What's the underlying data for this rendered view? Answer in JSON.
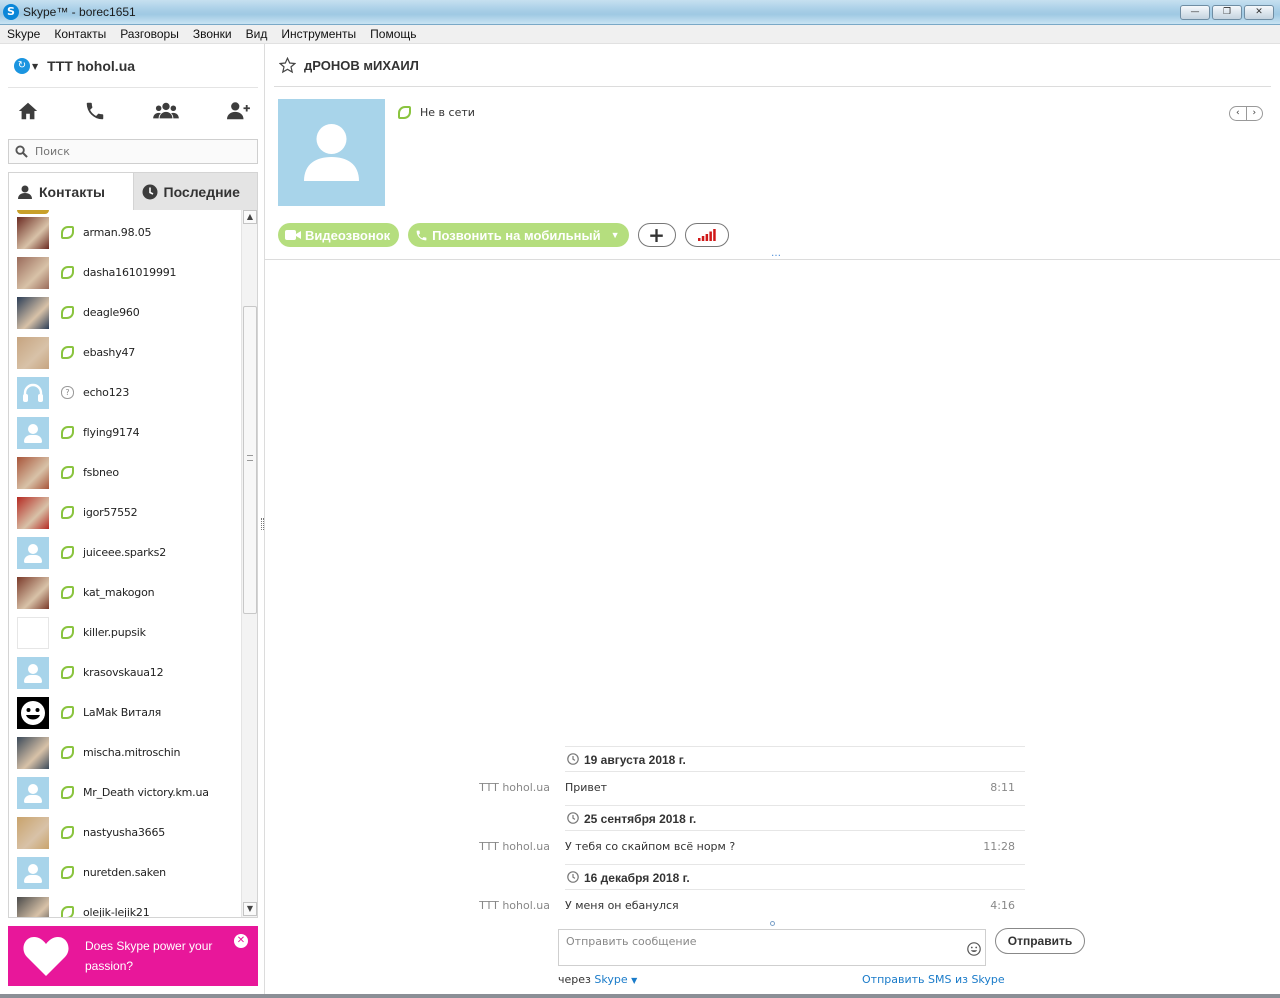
{
  "window": {
    "title": "Skype™ - borec1651",
    "app_icon_letter": "S",
    "minimize": "—",
    "restore": "❐",
    "close": "✕"
  },
  "menu": [
    "Skype",
    "Контакты",
    "Разговоры",
    "Звонки",
    "Вид",
    "Инструменты",
    "Помощь"
  ],
  "profile": {
    "name": "TTT hohol.ua"
  },
  "search": {
    "placeholder": "Поиск"
  },
  "tabs": {
    "contacts": "Контакты",
    "recent": "Последние"
  },
  "contacts": [
    {
      "name": "arman.98.05",
      "avatar": "photo",
      "color": "#6b2b22",
      "status": "offline"
    },
    {
      "name": "dasha161019991",
      "avatar": "photo",
      "color": "#9a6b5b",
      "status": "offline"
    },
    {
      "name": "deagle960",
      "avatar": "photo",
      "color": "#2c3e57",
      "status": "offline"
    },
    {
      "name": "ebashy47",
      "avatar": "photo",
      "color": "#c6a480",
      "status": "offline"
    },
    {
      "name": "echo123",
      "avatar": "headset",
      "color": "#a8d4ea",
      "status": "unknown"
    },
    {
      "name": "flying9174",
      "avatar": "default",
      "color": "#a8d4ea",
      "status": "offline"
    },
    {
      "name": "fsbneo",
      "avatar": "photo",
      "color": "#a8553a",
      "status": "offline"
    },
    {
      "name": "igor57552",
      "avatar": "photo",
      "color": "#b52a23",
      "status": "offline"
    },
    {
      "name": "juiceee.sparks2",
      "avatar": "default",
      "color": "#a8d4ea",
      "status": "offline"
    },
    {
      "name": "kat_makogon",
      "avatar": "photo",
      "color": "#7a3a2a",
      "status": "offline"
    },
    {
      "name": "killer.pupsik",
      "avatar": "white",
      "color": "#ffffff",
      "status": "offline"
    },
    {
      "name": "krasovskaua12",
      "avatar": "default",
      "color": "#a8d4ea",
      "status": "offline"
    },
    {
      "name": "LaMak Виталя",
      "avatar": "smiley",
      "color": "#000000",
      "status": "offline"
    },
    {
      "name": "mischa.mitroschin",
      "avatar": "photo",
      "color": "#3c4a5a",
      "status": "offline"
    },
    {
      "name": "Mr_Death victory.km.ua",
      "avatar": "default",
      "color": "#a8d4ea",
      "status": "offline"
    },
    {
      "name": "nastyusha3665",
      "avatar": "photo",
      "color": "#c9a36c",
      "status": "offline"
    },
    {
      "name": "nuretden.saken",
      "avatar": "default",
      "color": "#a8d4ea",
      "status": "offline"
    },
    {
      "name": "olejik-lejik21",
      "avatar": "photo",
      "color": "#4a4a4a",
      "status": "offline"
    }
  ],
  "promo": {
    "text": "Does Skype power your passion?",
    "close": "✕"
  },
  "chat": {
    "name": "дРОНОВ мИХАИЛ",
    "presence": "Не в сети",
    "video_call": "Видеозвонок",
    "call_mobile": "Позвонить на мобильный",
    "add": "+",
    "dots": "…"
  },
  "history": [
    {
      "date": "19 августа 2018 г.",
      "sender": "TTT hohol.ua",
      "text": "Привет",
      "time": "8:11"
    },
    {
      "date": "25 сентября 2018 г.",
      "sender": "TTT hohol.ua",
      "text": "У тебя со скайпом всё норм ?",
      "time": "11:28"
    },
    {
      "date": "16 декабря 2018 г.",
      "sender": "TTT hohol.ua",
      "text": "У меня он ебанулся",
      "time": "4:16"
    }
  ],
  "composer": {
    "placeholder": "Отправить сообщение",
    "send": "Отправить",
    "via_prefix": "через",
    "via_link": "Skype",
    "sms_link": "Отправить SMS из Skype"
  },
  "colors": {
    "brand": "#0a86d8",
    "status_offline": "#8ac43f",
    "call_button": "#b5de7e",
    "promo": "#e8179a",
    "link": "#1a7bc9"
  }
}
